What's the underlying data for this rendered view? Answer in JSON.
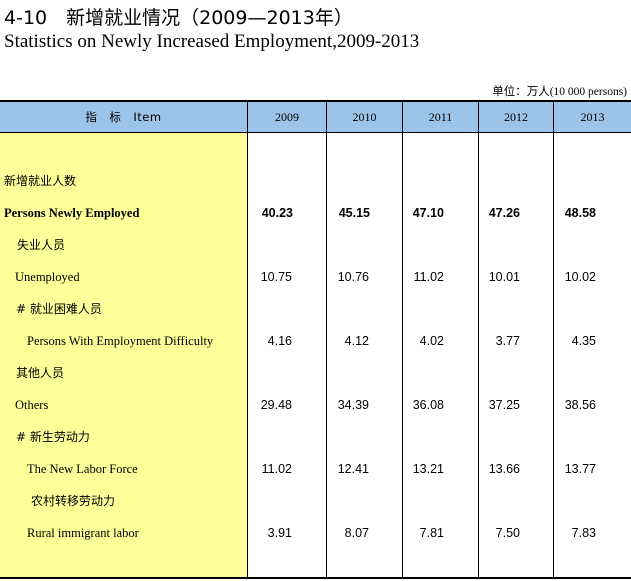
{
  "title": {
    "cn": "4-10　新增就业情况（2009—2013年）",
    "en": "Statistics on Newly Increased Employment,2009-2013"
  },
  "unit_label": "单位：万人(10 000 persons)",
  "header": {
    "indicator_label": "指　标　Item",
    "years": [
      "2009",
      "2010",
      "2011",
      "2012",
      "2013"
    ]
  },
  "rows": [
    {
      "label": "新增就业人数",
      "values": [
        "",
        "",
        "",
        "",
        ""
      ]
    },
    {
      "label": "Persons Newly Employed",
      "values": [
        "40.23",
        "45.15",
        "47.10",
        "47.26",
        "48.58"
      ]
    },
    {
      "label": "失业人员",
      "values": [
        "",
        "",
        "",
        "",
        ""
      ]
    },
    {
      "label": "Unemployed",
      "values": [
        "10.75",
        "10.76",
        "11.02",
        "10.01",
        "10.02"
      ]
    },
    {
      "label": "#  就业困难人员",
      "values": [
        "",
        "",
        "",
        "",
        ""
      ]
    },
    {
      "label": "Persons With Employment Difficulty",
      "values": [
        "4.16",
        "4.12",
        "4.02",
        "3.77",
        "4.35"
      ]
    },
    {
      "label": "其他人员",
      "values": [
        "",
        "",
        "",
        "",
        ""
      ]
    },
    {
      "label": "Others",
      "values": [
        "29.48",
        "34.39",
        "36.08",
        "37.25",
        "38.56"
      ]
    },
    {
      "label": "#  新生劳动力",
      "values": [
        "",
        "",
        "",
        "",
        ""
      ]
    },
    {
      "label": "The New Labor Force",
      "values": [
        "11.02",
        "12.41",
        "13.21",
        "13.66",
        "13.77"
      ]
    },
    {
      "label": "农村转移劳动力",
      "values": [
        "",
        "",
        "",
        "",
        ""
      ]
    },
    {
      "label": "Rural immigrant labor",
      "values": [
        "3.91",
        "8.07",
        "7.81",
        "7.50",
        "7.83"
      ]
    }
  ],
  "colors": {
    "header_bg": "#9cc3e8",
    "label_column_bg": "#ffff99"
  }
}
